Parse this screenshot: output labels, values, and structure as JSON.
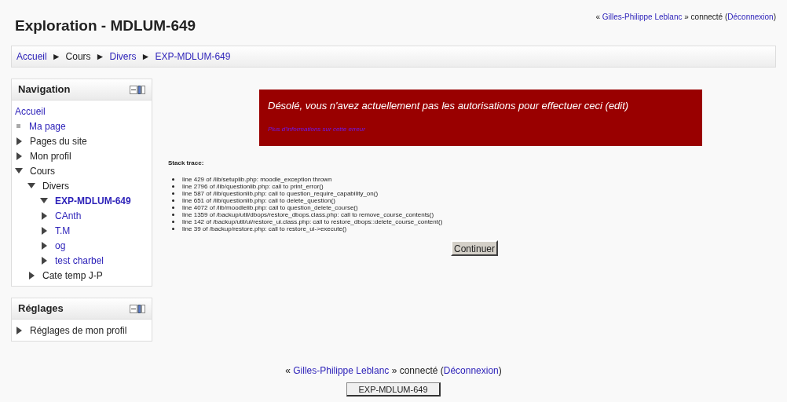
{
  "header": {
    "title": "Exploration - MDLUM-649",
    "login": {
      "prefix": "«",
      "user": "Gilles-Philippe Leblanc",
      "middle": "» connecté (",
      "logout": "Déconnexion",
      "suffix": ")"
    }
  },
  "breadcrumb": {
    "separator": "►",
    "items": [
      {
        "label": "Accueil",
        "link": true
      },
      {
        "label": "Cours",
        "link": false
      },
      {
        "label": "Divers",
        "link": true
      },
      {
        "label": "EXP-MDLUM-649",
        "link": true
      }
    ]
  },
  "navigation": {
    "title": "Navigation",
    "items": [
      {
        "label": "Accueil",
        "kind": "root",
        "link": true,
        "current": false
      },
      {
        "label": "Ma page",
        "kind": "leaf",
        "link": true,
        "current": false
      },
      {
        "label": "Pages du site",
        "kind": "branch",
        "expanded": false,
        "link": false,
        "current": false
      },
      {
        "label": "Mon profil",
        "kind": "branch",
        "expanded": false,
        "link": false,
        "current": false
      },
      {
        "label": "Cours",
        "kind": "branch",
        "expanded": true,
        "link": false,
        "current": false,
        "children": [
          {
            "label": "Divers",
            "kind": "branch",
            "expanded": true,
            "link": false,
            "current": false,
            "children": [
              {
                "label": "EXP-MDLUM-649",
                "kind": "branch",
                "expanded": true,
                "link": true,
                "current": true
              },
              {
                "label": "CAnth",
                "kind": "branch",
                "expanded": false,
                "link": true,
                "current": false
              },
              {
                "label": "T.M",
                "kind": "branch",
                "expanded": false,
                "link": true,
                "current": false
              },
              {
                "label": "og",
                "kind": "branch",
                "expanded": false,
                "link": true,
                "current": false
              },
              {
                "label": "test charbel",
                "kind": "branch",
                "expanded": false,
                "link": true,
                "current": false
              }
            ]
          },
          {
            "label": "Cate temp J-P",
            "kind": "branch",
            "expanded": false,
            "link": false,
            "current": false
          }
        ]
      }
    ]
  },
  "settings": {
    "title": "Réglages",
    "items": [
      {
        "label": "Réglages de mon profil",
        "kind": "branch",
        "expanded": false,
        "link": false,
        "current": false
      }
    ]
  },
  "error": {
    "message": "Désolé, vous n'avez actuellement pas les autorisations pour effectuer ceci (edit)",
    "more_info": "Plus d'informations sur cette erreur"
  },
  "stack_trace": {
    "title": "Stack trace:",
    "lines": [
      "line 429 of /lib/setuplib.php: moodle_exception thrown",
      "line 2796 of /lib/questionlib.php: call to print_error()",
      "line 587 of /lib/questionlib.php: call to question_require_capability_on()",
      "line 651 of /lib/questionlib.php: call to delete_question()",
      "line 4072 of /lib/moodlelib.php: call to question_delete_course()",
      "line 1359 of /backup/util/dbops/restore_dbops.class.php: call to remove_course_contents()",
      "line 142 of /backup/util/ui/restore_ui.class.php: call to restore_dbops::delete_course_content()",
      "line 39 of /backup/restore.php: call to restore_ui->execute()"
    ]
  },
  "continue_button": "Continuer",
  "footer": {
    "login": {
      "prefix": "«",
      "user": "Gilles-Philippe Leblanc",
      "middle": "» connecté (",
      "logout": "Déconnexion",
      "suffix": ")"
    },
    "course_button": "EXP-MDLUM-649"
  }
}
